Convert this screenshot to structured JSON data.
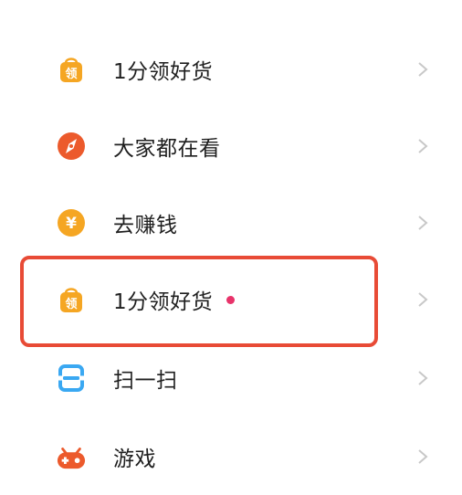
{
  "menu": {
    "items": [
      {
        "label": "1分领好货",
        "icon": "shopping-bag-icon",
        "icon_char": "领",
        "has_dot": false
      },
      {
        "label": "大家都在看",
        "icon": "compass-icon",
        "has_dot": false
      },
      {
        "label": "去赚钱",
        "icon": "yuan-coin-icon",
        "icon_char": "¥",
        "has_dot": false
      },
      {
        "label": "1分领好货",
        "icon": "shopping-bag-icon",
        "icon_char": "领",
        "has_dot": true
      },
      {
        "label": "扫一扫",
        "icon": "scan-icon",
        "has_dot": false
      },
      {
        "label": "游戏",
        "icon": "gamepad-icon",
        "has_dot": false
      }
    ]
  },
  "colors": {
    "bag": "#f5a623",
    "compass": "#ec5a2c",
    "coin": "#f5a623",
    "scan": "#3aa8f2",
    "game": "#ec5a2c",
    "dot": "#e8336a",
    "highlight": "#e84b36",
    "chevron": "#c8c8c8"
  }
}
